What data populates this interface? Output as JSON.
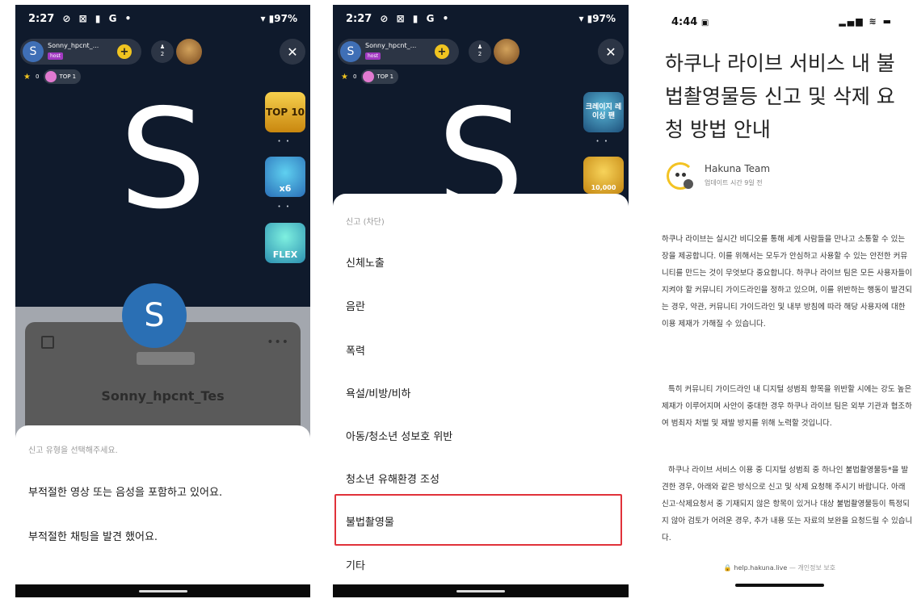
{
  "panel1": {
    "status": {
      "time": "2:27",
      "icons": "⊘ ⊠ ▮ G •",
      "right": "▾ ▮97%"
    },
    "host": {
      "avatar_letter": "S",
      "name": "Sonny_hpcnt_...",
      "badge": "host"
    },
    "viewer_count": "2",
    "rank": {
      "stars": "0",
      "label": "TOP 1"
    },
    "big_letter": "S",
    "badges": [
      "TOP 10",
      "x6",
      "FLEX"
    ],
    "profile": {
      "avatar_letter": "S",
      "name": "Sonny_hpcnt_Tes"
    },
    "sheet": {
      "title": "신고 유형을 선택해주세요.",
      "items": [
        "부적절한 영상 또는 음성을 포함하고 있어요.",
        "부적절한 채팅을 발견 했어요."
      ]
    }
  },
  "panel2": {
    "status": {
      "time": "2:27",
      "icons": "⊘ ⊠ ▮ G •",
      "right": "▾ ▮97%"
    },
    "host": {
      "avatar_letter": "S",
      "name": "Sonny_hpcnt_...",
      "badge": "host"
    },
    "viewer_count": "2",
    "rank": {
      "stars": "0",
      "label": "TOP 1"
    },
    "big_letter": "S",
    "badges": [
      "크레이지 레이싱 팬",
      "10,000"
    ],
    "sheet": {
      "title": "신고 (차단)",
      "items": [
        "신체노출",
        "음란",
        "폭력",
        "욕설/비방/비하",
        "아동/청소년 성보호 위반",
        "청소년 유해환경 조성",
        "불법촬영물",
        "기타"
      ],
      "highlighted_index": 6
    }
  },
  "panel3": {
    "status": {
      "time": "4:44",
      "right": "▂▄▆ ≋ ▬"
    },
    "title": "하쿠나 라이브 서비스 내 불법촬영물등 신고 및 삭제 요청 방법 안내",
    "author": {
      "name": "Hakuna Team",
      "meta": "업데이트 시간 9일 전"
    },
    "paragraphs": [
      "하쿠나 라이브는 실시간 비디오를 통해 세계 사람들을 만나고 소통할 수 있는 장을 제공합니다. 이를 위해서는 모두가 안심하고 사용할 수 있는 안전한 커뮤니티를 만드는 것이 무엇보다 중요합니다. 하쿠나 라이브 팀은 모든 사용자들이 지켜야 할 커뮤니티 가이드라인을 정하고 있으며, 이를 위반하는 행동이 발견되는 경우, 약관, 커뮤니티 가이드라인 및 내부 방침에 따라 해당 사용자에 대한 이용 제재가 가해질 수 있습니다.",
      "특히 커뮤니티 가이드라인 내 디지털 성범죄 항목을 위반할 시에는 강도 높은 제재가 이루어지며 사안이 중대한 경우 하쿠나 라이브 팀은 외부 기관과 협조하여 범죄자 처벌 및 재발 방지를 위해 노력할 것입니다.",
      "하쿠나 라이브 서비스 이용 중 디지털 성범죄 중 하나인 불법촬영물등*을 발견한 경우, 아래와 같은 방식으로 신고 및 삭제 요청해 주시기 바랍니다. 아래 신고·삭제요청서 중 기재되지 않은 항목이 있거나 대상 불법촬영물등이 특정되지 않아 검토가 어려운 경우, 추가 내용 또는 자료의 보완을 요청드릴 수 있습니다."
    ],
    "footer": {
      "lock": "🔒",
      "url": "help.hakuna.live",
      "separator": "—",
      "note": "개인정보 보호"
    }
  }
}
